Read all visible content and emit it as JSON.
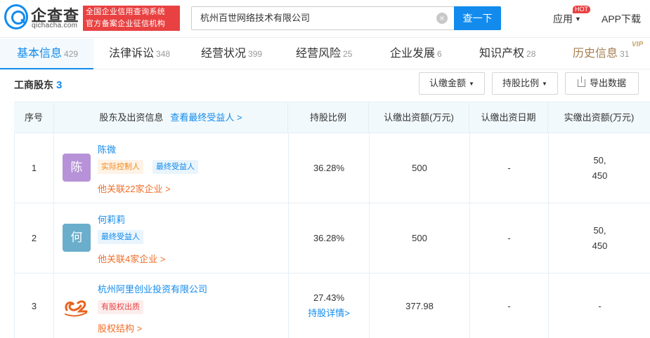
{
  "brand": {
    "name": "企查查",
    "domain": "qichacha.com",
    "slogan_line1": "全国企业信用查询系统",
    "slogan_line2": "官方备案企业征信机构",
    "accent": "#128bed"
  },
  "search": {
    "value": "杭州百世网络技术有限公司",
    "button": "查一下",
    "clear_icon": "clear-icon"
  },
  "nav": {
    "apps": "应用",
    "hot": "HOT",
    "app_download": "APP下载"
  },
  "tabs": [
    {
      "label": "基本信息",
      "count": "429"
    },
    {
      "label": "法律诉讼",
      "count": "348"
    },
    {
      "label": "经营状况",
      "count": "399"
    },
    {
      "label": "经营风险",
      "count": "25"
    },
    {
      "label": "企业发展",
      "count": "6"
    },
    {
      "label": "知识产权",
      "count": "28"
    },
    {
      "label": "历史信息",
      "count": "31"
    }
  ],
  "vip": "VIP",
  "section": {
    "title": "工商股东",
    "count": "3"
  },
  "filters": {
    "amount": "认缴金额",
    "ratio": "持股比例",
    "export": "导出数据"
  },
  "table": {
    "headers": {
      "index": "序号",
      "holder": "股东及出资信息",
      "beneficiary_link": "查看最终受益人 >",
      "ratio": "持股比例",
      "subscribed": "认缴出资额(万元)",
      "date": "认缴出资日期",
      "paid": "实缴出资额(万元)"
    },
    "rows": [
      {
        "index": "1",
        "avatar": "陈",
        "avatar_color": "#b792d8",
        "name": "陈微",
        "tags": [
          "实际控制人",
          "最终受益人"
        ],
        "related": "他关联22家企业 >",
        "ratio": "36.28%",
        "subscribed": "500",
        "date": "-",
        "paid_line1": "50,",
        "paid_line2": "450"
      },
      {
        "index": "2",
        "avatar": "何",
        "avatar_color": "#6aaecb",
        "name": "何莉莉",
        "tags": [
          "最终受益人"
        ],
        "related": "他关联4家企业 >",
        "ratio": "36.28%",
        "subscribed": "500",
        "date": "-",
        "paid_line1": "50,",
        "paid_line2": "450"
      },
      {
        "index": "3",
        "name": "杭州阿里创业投资有限公司",
        "tags": [
          "有股权出质"
        ],
        "related": "股权结构 >",
        "ratio": "27.43%",
        "ratio_link": "持股详情>",
        "subscribed": "377.98",
        "date": "-",
        "paid": "-"
      }
    ]
  }
}
